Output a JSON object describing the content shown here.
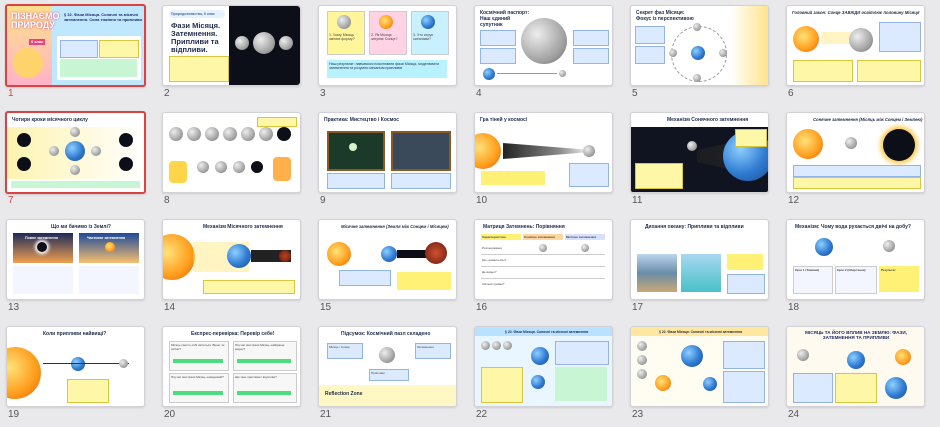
{
  "slides": [
    {
      "num": "1",
      "title": "ПІЗНАЄМО ПРИРОДУ",
      "subtitle": "§ 22. Фази Місяця. Сонячні та місячні затемнення. Сила тяжіння та припливи",
      "grade": "6 клас"
    },
    {
      "num": "2",
      "title": "Фази Місяця. Затемнення. Припливи та відпливи.",
      "tag": "Природознавство, 6 клас"
    },
    {
      "num": "3",
      "title": "Наш результат: навчимося пояснювати фази Місяця, моделювати затемнення та розуміти механізм припливів"
    },
    {
      "num": "4",
      "title": "Космічний паспорт: Наш єдиний супутник"
    },
    {
      "num": "5",
      "title": "Секрет фаз Місяця: Фокус із перспективою"
    },
    {
      "num": "6",
      "title": "Головний закон: Сонце ЗАВЖДИ освітлює половину Місяця"
    },
    {
      "num": "7",
      "title": "Чотири кроки місячного циклу"
    },
    {
      "num": "8",
      "title": "Фази Місяця"
    },
    {
      "num": "9",
      "title": "Практика: Мистецтво і Космос"
    },
    {
      "num": "10",
      "title": "Гра тіней у космосі"
    },
    {
      "num": "11",
      "title": "Механізм Сонячного затемнення"
    },
    {
      "num": "12",
      "title": "Сонячне затемнення (Місяць між Сонцем і Землею)"
    },
    {
      "num": "13",
      "title": "Що ми бачимо із Землі?"
    },
    {
      "num": "14",
      "title": "Механізм Місячного затемнення"
    },
    {
      "num": "15",
      "title": "Місячне затемнення (Земля між Сонцем і Місяцем)"
    },
    {
      "num": "16",
      "title": "Матриця Затемнень: Порівняння"
    },
    {
      "num": "17",
      "title": "Дихання океану: Припливи та відпливи"
    },
    {
      "num": "18",
      "title": "Механізм: Чому вода рухається двічі на добу?"
    },
    {
      "num": "19",
      "title": "Коли припливи найвищі?"
    },
    {
      "num": "20",
      "title": "Експрес-перевірка: Перевір себе!"
    },
    {
      "num": "21",
      "title": "Підсумок: Космічний пазл складено",
      "footer": "Reflection Zone"
    },
    {
      "num": "22",
      "title": "§ 22. Фази Місяця. Сонячні та місячні затемнення"
    },
    {
      "num": "23",
      "title": "§ 22. Фази Місяця. Сонячні та місячні затемнення"
    },
    {
      "num": "24",
      "title": "МІСЯЦЬ ТА ЙОГО ВПЛИВ НА ЗЕМЛЮ: ФАЗИ, ЗАТЕМНЕННЯ ТА ПРИПЛИВИ"
    }
  ],
  "texts": {
    "s3_cards": [
      "1. Чому Місяць змінює форму?",
      "2. Як Місяць затуляє Сонце?",
      "3. Хто керує океанами?"
    ],
    "s13_left": "Повне затемнення",
    "s13_right": "Часткове затемнення",
    "s16_headers": [
      "Характеристика",
      "Сонячне затемнення",
      "Місячне затемнення"
    ],
    "s16_rows": [
      "Розташування",
      "Що «ховається»?",
      "Де видно?",
      "Скільки триває?"
    ],
    "s18_boxes": [
      "Крок 1 (Тяжіння)",
      "Крок 2 (Обертання)",
      "Результат"
    ],
    "s20_q": [
      "Місяць сам по собі світиться. Вірно чи хибно?",
      "Під час якої фази Місяць найкраще видно?",
      "Під час якої фази Місяць невидимий?",
      "Що таке припливи і відпливи?"
    ],
    "s21_nodes": [
      "Місяць і Сонце",
      "Затемнення",
      "Припливи"
    ]
  }
}
